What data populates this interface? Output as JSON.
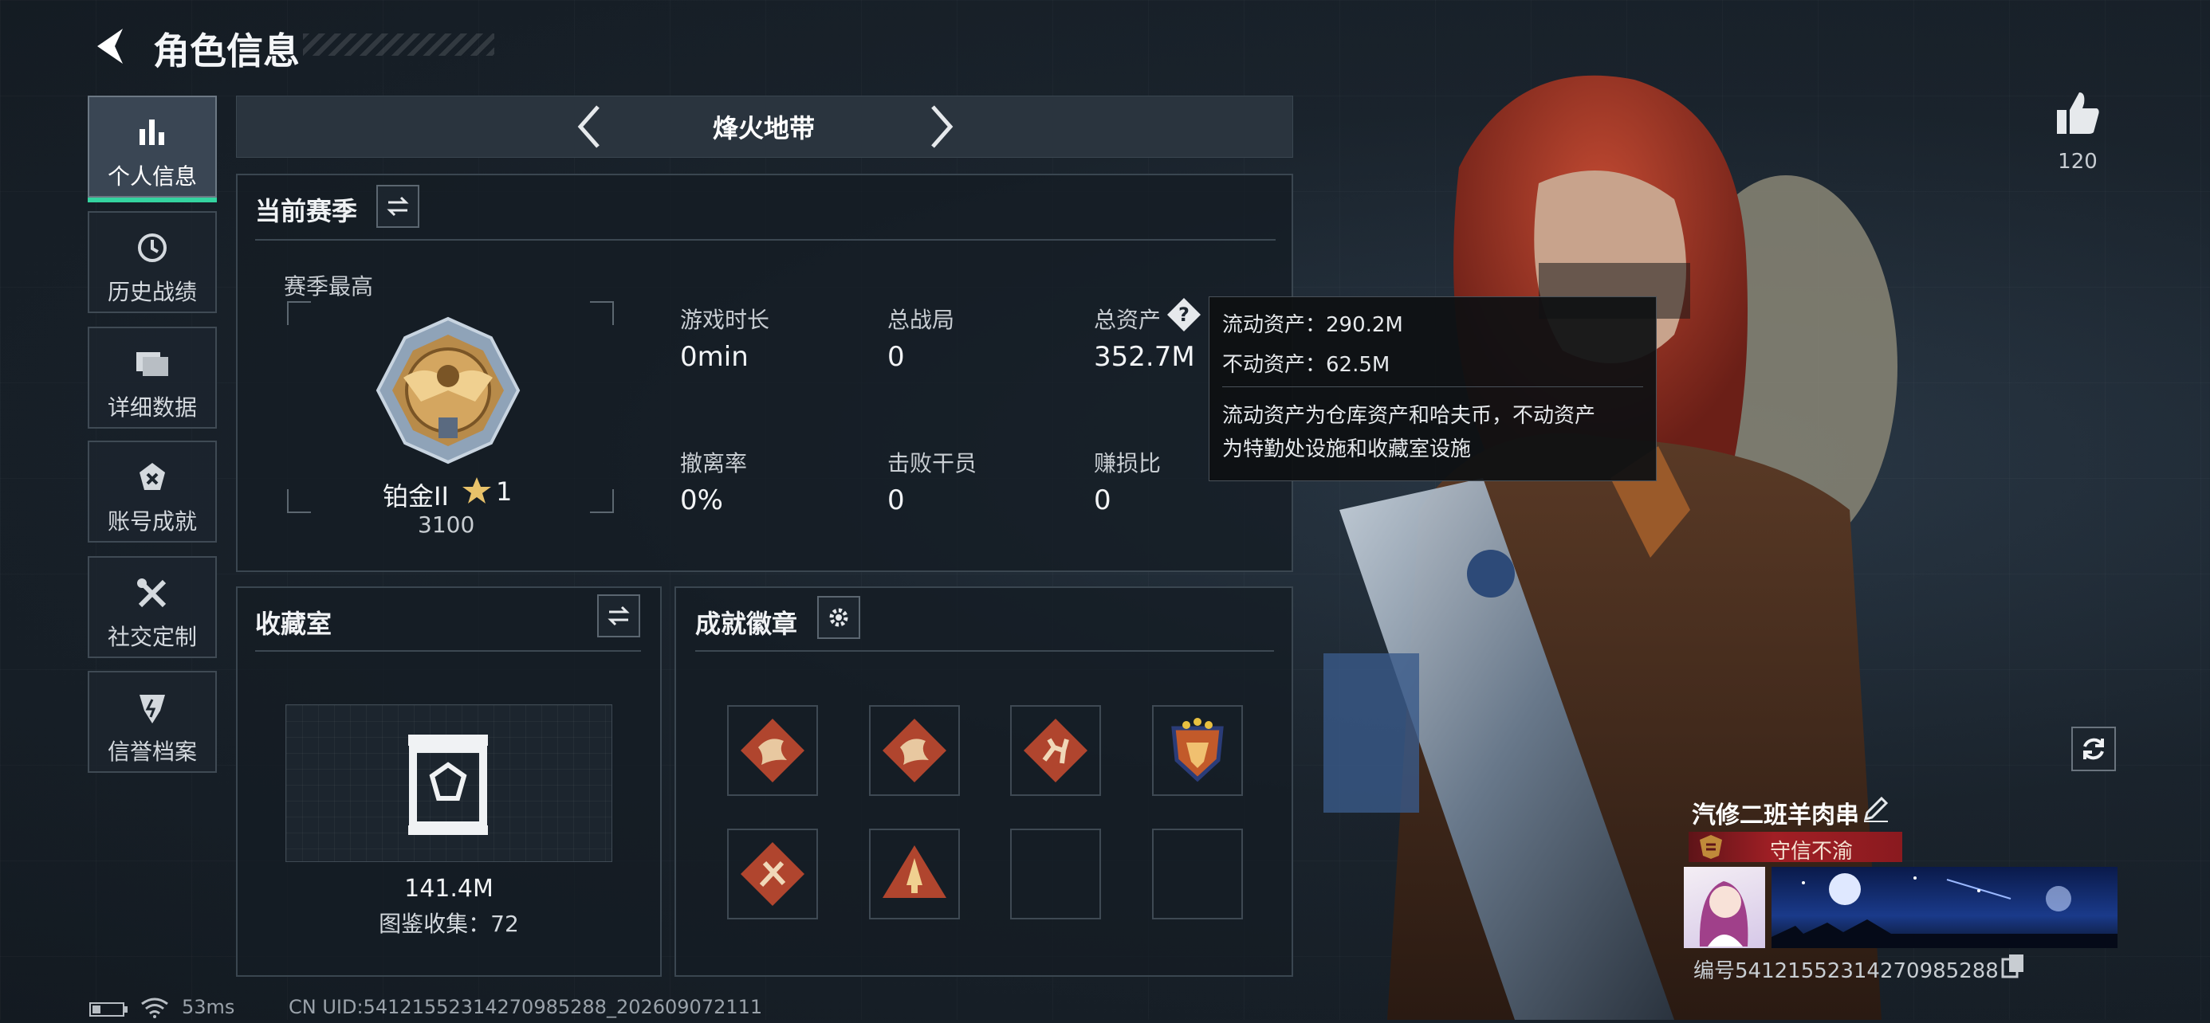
{
  "header": {
    "title": "角色信息"
  },
  "sidebar": {
    "items": [
      {
        "label": "个人信息",
        "icon": "bar-chart-icon",
        "active": true
      },
      {
        "label": "历史战绩",
        "icon": "clock-icon",
        "active": false
      },
      {
        "label": "详细数据",
        "icon": "folder-icon",
        "active": false
      },
      {
        "label": "账号成就",
        "icon": "medal-icon",
        "active": false
      },
      {
        "label": "社交定制",
        "icon": "wrench-icon",
        "active": false
      },
      {
        "label": "信誉档案",
        "icon": "shield-icon",
        "active": false
      }
    ]
  },
  "mode_switch": {
    "label": "烽火地带"
  },
  "season": {
    "title": "当前赛季",
    "best_label": "赛季最高",
    "rank_name": "铂金II",
    "rank_stars": "1",
    "rank_score": "3100",
    "stats": [
      {
        "label": "游戏时长",
        "value": "0min"
      },
      {
        "label": "总战局",
        "value": "0"
      },
      {
        "label": "总资产",
        "value": "352.7M"
      },
      {
        "label": "撤离率",
        "value": "0%"
      },
      {
        "label": "击败干员",
        "value": "0"
      },
      {
        "label": "赚损比",
        "value": "0"
      }
    ]
  },
  "tooltip": {
    "liquid": "流动资产：290.2M",
    "fixed": "不动资产：62.5M",
    "desc_line1": "流动资产为仓库资产和哈夫币，不动资产",
    "desc_line2": "为特勤处设施和收藏室设施"
  },
  "collection": {
    "title": "收藏室",
    "value": "141.4M",
    "codex": "图鉴收集：72"
  },
  "achievements": {
    "title": "成就徽章",
    "badges": [
      "dragon-badge-icon",
      "dragon-badge-icon",
      "runner-badge-icon",
      "shield-stars-badge-icon",
      "tools-badge-icon",
      "rocket-badge-icon",
      "",
      ""
    ]
  },
  "profile": {
    "likes": "120",
    "name": "汽修二班羊肉串",
    "title": "守信不渝",
    "id_text": "编号5412155231427098528​8"
  },
  "status_bar": {
    "ping": "53ms",
    "uid": "CN UID:5412155231427098528​8_202609072111"
  },
  "colors": {
    "accent_red": "#a11f25",
    "active_tab": "#3a4654",
    "panel_border": "#3a4650"
  }
}
